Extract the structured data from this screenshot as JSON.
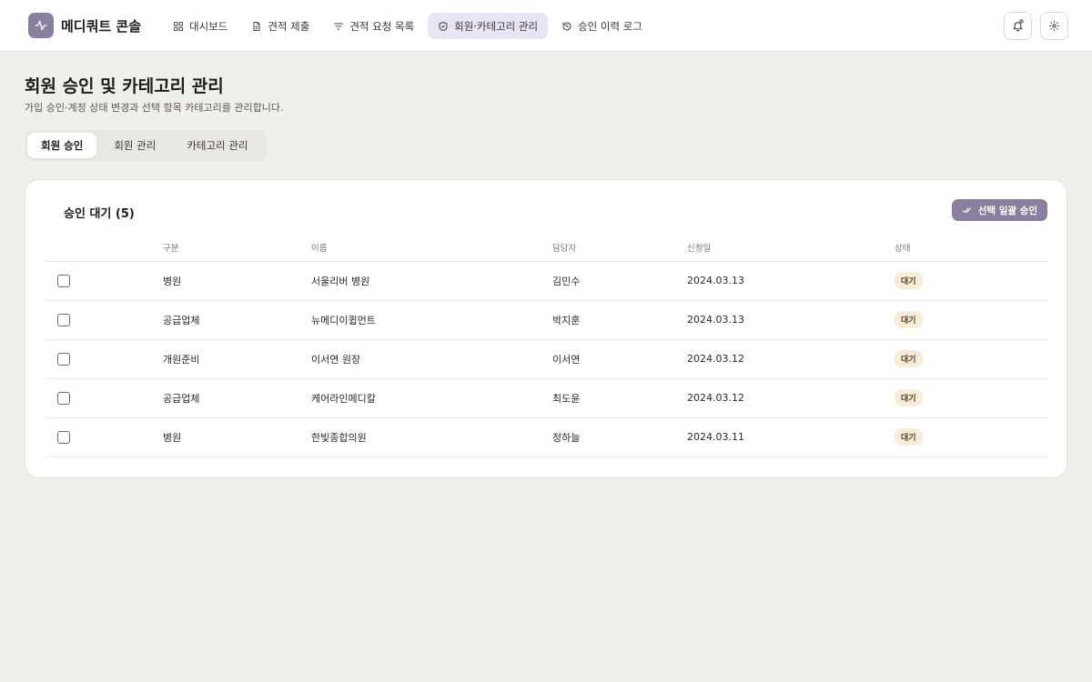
{
  "brand": {
    "name": "메디쿼트 콘솔"
  },
  "nav": [
    {
      "label": "대시보드",
      "icon": "grid-icon"
    },
    {
      "label": "견적 제출",
      "icon": "file-icon"
    },
    {
      "label": "견적 요청 목록",
      "icon": "filter-icon"
    },
    {
      "label": "회원·카테고리 관리",
      "icon": "shield-icon",
      "active": true
    },
    {
      "label": "승인 이력 로그",
      "icon": "history-icon"
    }
  ],
  "page": {
    "title": "회원 승인 및 카테고리 관리",
    "subtitle": "가입 승인·계정 상태 변경과 선택 항목 카테고리를 관리합니다."
  },
  "tabs": [
    {
      "label": "회원 승인",
      "active": true
    },
    {
      "label": "회원 관리"
    },
    {
      "label": "카테고리 관리"
    }
  ],
  "card": {
    "title": "승인 대기 (5)",
    "bulk_button": "선택 일괄 승인"
  },
  "table": {
    "headers": [
      "구분",
      "이름",
      "담당자",
      "신청일",
      "상태"
    ],
    "rows": [
      {
        "type": "병원",
        "name": "서울리버 병원",
        "manager": "김민수",
        "date": "2024.03.13",
        "status": "대기"
      },
      {
        "type": "공급업체",
        "name": "뉴메디이큅먼트",
        "manager": "박지훈",
        "date": "2024.03.13",
        "status": "대기"
      },
      {
        "type": "개원준비",
        "name": "이서연 원장",
        "manager": "이서연",
        "date": "2024.03.12",
        "status": "대기"
      },
      {
        "type": "공급업체",
        "name": "케어라인메디칼",
        "manager": "최도윤",
        "date": "2024.03.12",
        "status": "대기"
      },
      {
        "type": "병원",
        "name": "한빛종합의원",
        "manager": "정하늘",
        "date": "2024.03.11",
        "status": "대기"
      }
    ]
  },
  "colors": {
    "accent": "#8a7f9e",
    "nav_active_bg": "#e9e3f6",
    "badge_bg": "#f6ecd9",
    "background": "#f0efeb"
  }
}
